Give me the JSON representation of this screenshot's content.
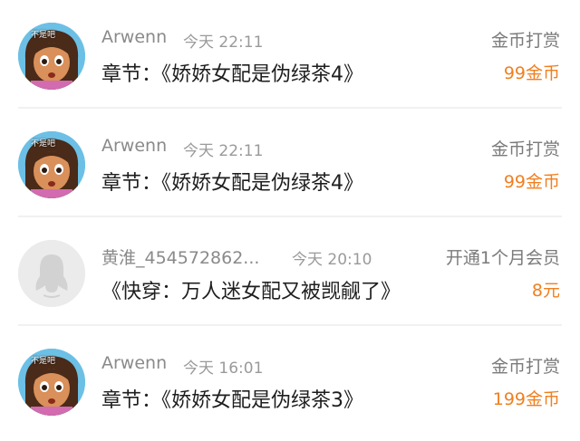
{
  "rows": [
    {
      "avatar_icon": "dora-cartoon-avatar-icon",
      "avatar_caption": "不是吧",
      "name": "Arwenn",
      "time": "今天 22:11",
      "action": "金币打赏",
      "title": "章节：《娇娇女配是伪绿茶4》",
      "amount": "99金币"
    },
    {
      "avatar_icon": "dora-cartoon-avatar-icon",
      "avatar_caption": "不是吧",
      "name": "Arwenn",
      "time": "今天 22:11",
      "action": "金币打赏",
      "title": "章节：《娇娇女配是伪绿茶4》",
      "amount": "99金币"
    },
    {
      "avatar_icon": "default-penguin-avatar-icon",
      "name": "黄淮_454572862...",
      "time": "今天 20:10",
      "action": "开通1个月会员",
      "title": "《快穿：万人迷女配又被觊觎了》",
      "amount": "8元"
    },
    {
      "avatar_icon": "dora-cartoon-avatar-icon",
      "avatar_caption": "不是吧",
      "name": "Arwenn",
      "time": "今天 16:01",
      "action": "金币打赏",
      "title": "章节：《娇娇女配是伪绿茶3》",
      "amount": "199金币"
    }
  ],
  "colors": {
    "amount": "#f07f1f",
    "name": "#8a8a8a",
    "title": "#1e1e1e",
    "divider": "#f1f1f1"
  }
}
